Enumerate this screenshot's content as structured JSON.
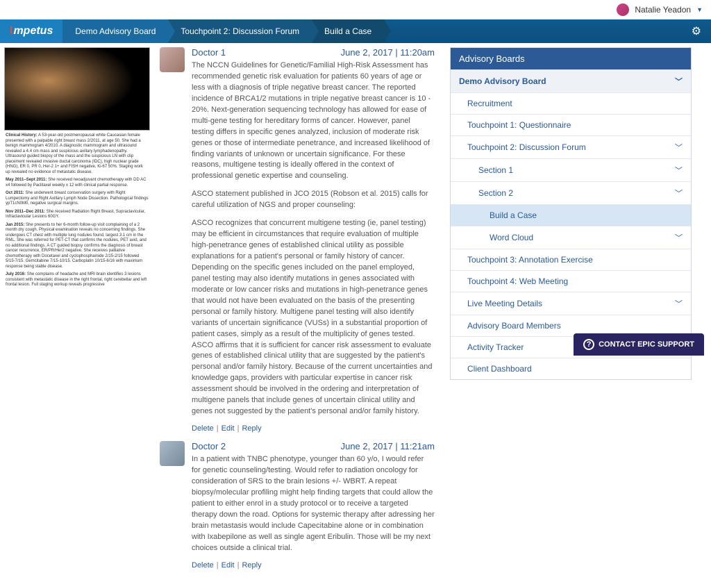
{
  "user": {
    "name": "Natalie Yeadon"
  },
  "brand": "mpetus",
  "crumbs": [
    "Demo Advisory Board",
    "Touchpoint 2: Discussion Forum",
    "Build a Case"
  ],
  "clinical": {
    "history_label": "Clinical History:",
    "history": "A 53-year-old postmenopausal white Caucasian female presented with a palpable right breast mass 2/2011, at age 50. She had a benign mammogram 4/2010. A diagnostic mammogram and ultrasound revealed a 4.4 cm mass and suspicious axillary lymphadenopathy. Ultrasound guided biopsy of the mass and the suspicious LN with clip placement revealed invasive ductal carcinoma (IDC), high nuclear grade (HNG), ER 0, PR 0, Her-2 1+ and FISH negative, Ki-67 50%. Staging work up revealed no evidence of metastatic disease.",
    "may2011_label": "May 2011–Sept 2011:",
    "may2011": "She received neoadjuvant chemotherapy with DD AC x4 followed by Paclitaxel weekly x 12 with clinical partial response.",
    "oct2011_label": "Oct 2011:",
    "oct2011": "She underwent breast conservation surgery with Right Lumpectomy and Right Axillary Lymph Node Dissection. Pathological findings ypT1cN0M0, negative surgical margins.",
    "nov2011_label": "Nov 2011–Dec 2011:",
    "nov2011": "She received Radiation Right Breast, Supraclavicular, Infraclavicular Lesions 60GY.",
    "jan2015_label": "Jan 2015:",
    "jan2015": "She presents to her 6-month follow-up visit complaining of a 2 month dry cough. Physical examination reveals no concerning findings. She undergoes CT chest with multiple lung nodules found, largest 3.1 cm in the RML. She was referred for PET-CT that confirms the nodules, PET avid, and no additional findings. A CT guided biopsy confirms the diagnosis of breast cancer recurrence, ER/PR/Her2 negative. She receives palliative chemotherapy with Docetaxel and cyclophosphamide 2/15-2/15 followed 5/15-7/15. Gemcitabine 7/15-10/15. Carboplatin 10/15-6/16 with maximum response being stable disease.",
    "july2016_label": "July 2016:",
    "july2016": "She complains of headache and MRI brain identifies 3 lesions consistent with metastatic disease in the right frontal, right cerebellar and left frontal lesion. Full staging workup reveals progressive"
  },
  "posts": [
    {
      "author": "Doctor 1",
      "ts": "June 2, 2017 | 11:20am",
      "p1": "The NCCN Guidelines for Genetic/Familial High-Risk Assessment has recommended genetic risk evaluation for patients 60 years of age or less with a diagnosis of triple negative breast cancer. The reported incidence of BRCA1/2 mutations in triple negative breast cancer is 10 - 20%. Next-generation sequencing technology has allowed for ease of multi-gene testing for hereditary forms of cancer. However, panel testing differs in specific genes analyzed, inclusion of moderate risk genes or those of intermediate penetrance, and increased likelihood of finding variants of unknown or uncertain significance. For these reasons, multigene testing is ideally offered in the context of professional genetic expertise and counseling.",
      "p2": "ASCO statement published in JCO 2015 (Robson et al. 2015) calls for careful utilization of NGS and proper counseling:",
      "p3": "ASCO recognizes that concurrent multigene testing (ie, panel testing) may be efficient in circumstances that require evaluation of multiple high-penetrance genes of established clinical utility as possible explanations for a patient's personal or family history of cancer. Depending on the specific genes included on the panel employed, panel testing may also identify mutations in genes associated with moderate or low cancer risks and mutations in high-penetrance genes that would not have been evaluated on the basis of the presenting personal or family history. Multigene panel testing will also identify variants of uncertain significance (VUSs) in a substantial proportion of patient cases, simply as a result of the multiplicity of genes tested. ASCO affirms that it is sufficient for cancer risk assessment to evaluate genes of established clinical utility that are suggested by the patient's personal and/or family history. Because of the current uncertainties and knowledge gaps, providers with particular expertise in cancer risk assessment should be involved in the ordering and interpretation of multigene panels that include genes of uncertain clinical utility and genes not suggested by the patient's personal and/or family history."
    },
    {
      "author": "Doctor 2",
      "ts": "June 2, 2017 | 11:21am",
      "p1": "In a patient with TNBC phenotype, younger than 60 y/o, I would refer for genetic counseling/testing. Would refer to radiation oncology for consideration of SRS to the brain lesions +/- WBRT. A repeat biopsy/molecular profiling might help finding targets that could allow the patient to either enrol in a study protocol or to receive a targeted therapy down the road. Options for systemic therapy after adressing her brain metastasis would include Capecitabine alone or in combination with Ixabepilone as well as single agent Eribulin. Those will be my next choices outside a clinical trial."
    }
  ],
  "actions": {
    "delete": "Delete",
    "edit": "Edit",
    "reply": "Reply"
  },
  "side": {
    "header": "Advisory Boards",
    "items": [
      {
        "label": "Demo Advisory Board",
        "lvl": 0,
        "exp": true
      },
      {
        "label": "Recruitment",
        "lvl": 1,
        "exp": false
      },
      {
        "label": "Touchpoint 1: Questionnaire",
        "lvl": 1,
        "exp": false
      },
      {
        "label": "Touchpoint 2: Discussion Forum",
        "lvl": 1,
        "exp": true
      },
      {
        "label": "Section 1",
        "lvl": 2,
        "exp": true
      },
      {
        "label": "Section 2",
        "lvl": 2,
        "exp": true
      },
      {
        "label": "Build a Case",
        "lvl": 3,
        "exp": false,
        "active": true
      },
      {
        "label": "Word Cloud",
        "lvl": 3,
        "exp": true
      },
      {
        "label": "Touchpoint 3: Annotation Exercise",
        "lvl": 1,
        "exp": false
      },
      {
        "label": "Touchpoint 4: Web Meeting",
        "lvl": 1,
        "exp": false
      },
      {
        "label": "Live Meeting Details",
        "lvl": 1,
        "exp": true
      },
      {
        "label": "Advisory Board Members",
        "lvl": 1,
        "exp": false
      },
      {
        "label": "Activity Tracker",
        "lvl": 1,
        "exp": false
      },
      {
        "label": "Client Dashboard",
        "lvl": 1,
        "exp": false
      }
    ]
  },
  "support": "CONTACT EPIC SUPPORT"
}
